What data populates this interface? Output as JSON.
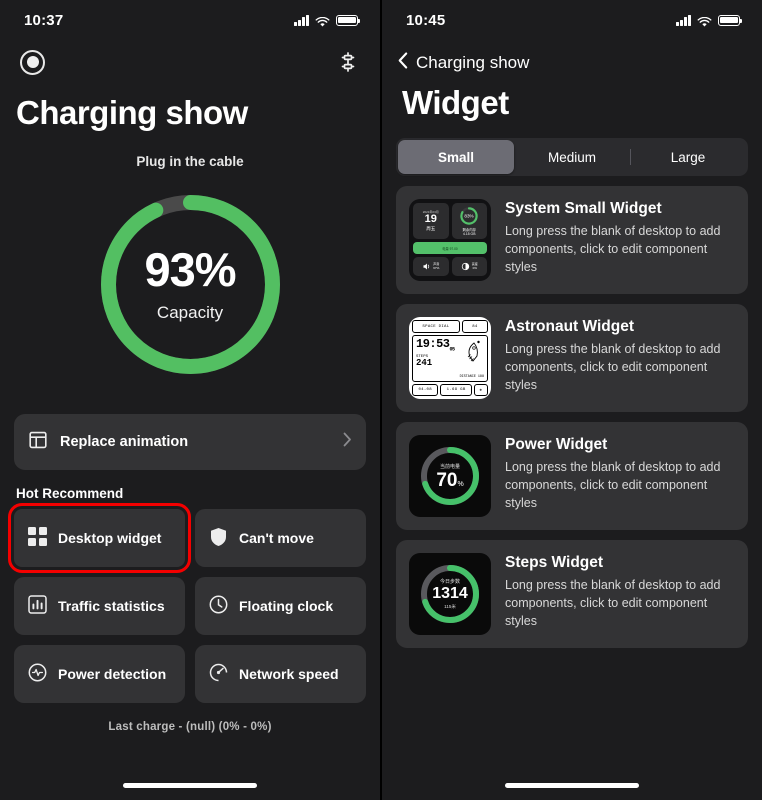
{
  "left": {
    "status": {
      "time": "10:37",
      "signal_icon": "cellular-signal-icon",
      "wifi_icon": "wifi-icon",
      "battery_icon": "battery-full-icon"
    },
    "record_icon": "record-circle-icon",
    "sliders_icon": "sliders-settings-icon",
    "title": "Charging show",
    "subtitle": "Plug in the cable",
    "gauge": {
      "percent_text": "93%",
      "percent_value": 93,
      "label": "Capacity",
      "track_color": "#4a4a4a",
      "fill_color": "#53bf62"
    },
    "replace_row": {
      "icon": "layout-template-icon",
      "label": "Replace animation",
      "chevron_icon": "chevron-right-icon"
    },
    "section_title": "Hot Recommend",
    "tiles": [
      {
        "label": "Desktop widget",
        "icon": "grid-squares-icon",
        "highlighted": true
      },
      {
        "label": "Can't move",
        "icon": "shield-icon",
        "highlighted": false
      },
      {
        "label": "Traffic statistics",
        "icon": "bar-chart-icon",
        "highlighted": false
      },
      {
        "label": "Floating clock",
        "icon": "clock-icon",
        "highlighted": false
      },
      {
        "label": "Power detection",
        "icon": "pulse-circle-icon",
        "highlighted": false
      },
      {
        "label": "Network speed",
        "icon": "speedometer-icon",
        "highlighted": false
      }
    ],
    "last_charge": "Last charge  -  (null) (0% - 0%)",
    "highlight_color": "#f40000"
  },
  "right": {
    "status": {
      "time": "10:45",
      "signal_icon": "cellular-signal-icon",
      "wifi_icon": "wifi-icon",
      "battery_icon": "battery-full-icon"
    },
    "back": {
      "icon": "chevron-left-icon",
      "label": "Charging show"
    },
    "title": "Widget",
    "segments": [
      {
        "label": "Small",
        "active": true
      },
      {
        "label": "Medium",
        "active": false
      },
      {
        "label": "Large",
        "active": false
      }
    ],
    "widgets": [
      {
        "title": "System Small Widget",
        "desc": "Long press the blank of desktop to add components, click to edit component styles",
        "thumb": "system-small-widget-preview",
        "preview": {
          "date_year": "2021年03月",
          "date_day": "19",
          "date_weekday": "周五",
          "ring_value": "83%",
          "storage_label": "剩余内存",
          "storage_value": "4.15 GB",
          "bar_label": "电量 97.00",
          "volume_label": "声音",
          "volume_value": "67%",
          "bright_label": "亮度",
          "bright_value": "0%"
        }
      },
      {
        "title": "Astronaut Widget",
        "desc": "Long press the blank of desktop to add components, click to edit component styles",
        "thumb": "astronaut-widget-preview",
        "preview": {
          "header_left": "SPACE DIAL",
          "header_right": "84",
          "time": "19:53",
          "time_small": "05",
          "steps_label": "STEPS",
          "steps_value": "241",
          "distance": "DISTANCE 188",
          "footer_date": "04-08",
          "footer_value": "1.69 GB"
        }
      },
      {
        "title": "Power Widget",
        "desc": "Long press the blank of desktop to add components, click to edit component styles",
        "thumb": "power-widget-preview",
        "preview": {
          "caption": "当前电量",
          "value": "70",
          "unit": "%",
          "percent": 70
        }
      },
      {
        "title": "Steps Widget",
        "desc": "Long press the blank of desktop to add components, click to edit component styles",
        "thumb": "steps-widget-preview",
        "preview": {
          "caption": "今日步数",
          "value": "1314",
          "unit": "",
          "sub": "115米",
          "percent": 70
        }
      }
    ]
  }
}
